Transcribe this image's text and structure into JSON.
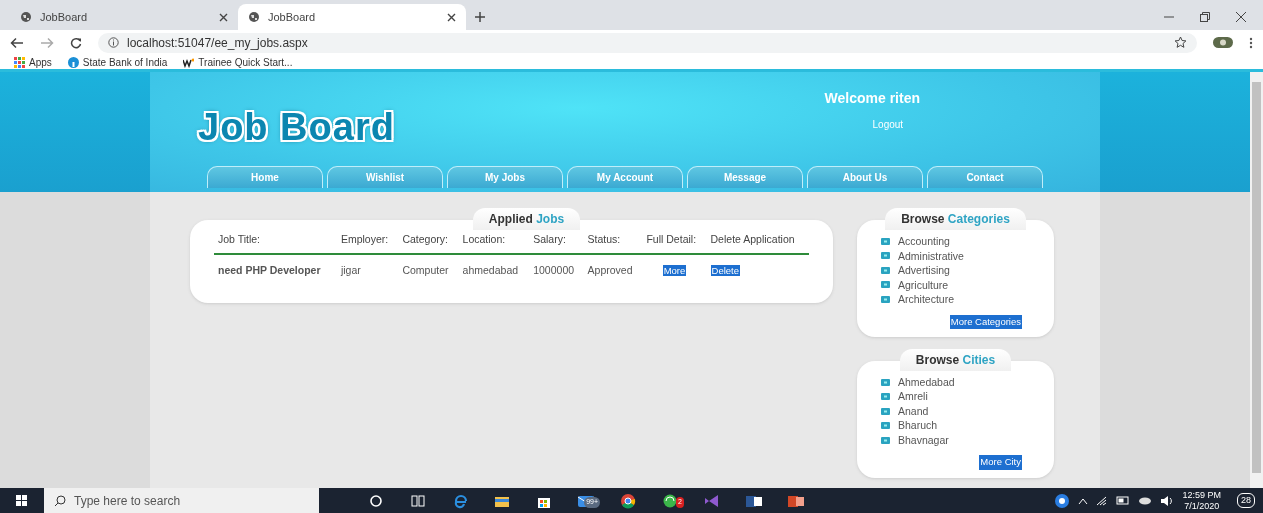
{
  "browser": {
    "tabs": [
      {
        "title": "JobBoard",
        "selected": false
      },
      {
        "title": "JobBoard",
        "selected": true
      }
    ],
    "address": "localhost:51047/ee_my_jobs.aspx",
    "bookmarks": [
      {
        "label": "Apps",
        "kind": "apps"
      },
      {
        "label": "State Bank of India",
        "kind": "bank"
      },
      {
        "label": "Trainee Quick Start...",
        "kind": "w"
      }
    ]
  },
  "header": {
    "logo": "Job Board",
    "welcome": "Welcome riten",
    "logout": "Logout",
    "nav": [
      "Home",
      "Wishlist",
      "My Jobs",
      "My Account",
      "Message",
      "About Us",
      "Contact"
    ]
  },
  "applied_jobs": {
    "title": "Applied",
    "title_highlight": "Jobs",
    "columns": [
      "Job Title:",
      "Employer:",
      "Category:",
      "Location:",
      "Salary:",
      "Status:",
      "Full Detail:",
      "Delete Application"
    ],
    "rows": [
      {
        "cells": [
          "need PHP Developer",
          "jigar",
          "Computer",
          "ahmedabad",
          "1000000",
          "Approved"
        ],
        "detail_link": "More",
        "delete_link": "Delete"
      }
    ]
  },
  "sidebar": [
    {
      "title": "Browse",
      "title_highlight": "Categories",
      "items": [
        "Accounting",
        "Administrative",
        "Advertising",
        "Agriculture",
        "Architecture"
      ],
      "more_link": "More Categories"
    },
    {
      "title": "Browse",
      "title_highlight": "Cities",
      "items": [
        "Ahmedabad",
        "Amreli",
        "Anand",
        "Bharuch",
        "Bhavnagar"
      ],
      "more_link": "More City"
    }
  ],
  "taskbar": {
    "search_placeholder": "Type here to search",
    "mail_badge": "99+",
    "chat_badge": "2",
    "time": "12:59 PM",
    "date": "7/1/2020",
    "notifications": "28"
  }
}
